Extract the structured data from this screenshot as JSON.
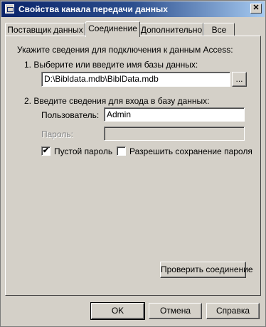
{
  "window": {
    "title": "Свойства канала передачи данных",
    "close_glyph": "✕"
  },
  "tabs": [
    {
      "label": "Поставщик данных"
    },
    {
      "label": "Соединение"
    },
    {
      "label": "Дополнительно"
    },
    {
      "label": "Все"
    }
  ],
  "connection": {
    "intro": "Укажите сведения для подключения к данным Access:",
    "step1_label": "1. Выберите или введите имя базы данных:",
    "db_path": "D:\\Bibldata.mdb\\BiblData.mdb",
    "browse_label": "...",
    "step2_label": "2. Введите сведения для входа в базу данных:",
    "user_label": "Пользователь:",
    "user_value": "Admin",
    "password_label": "Пароль:",
    "password_value": "",
    "blank_password_label": "Пустой пароль",
    "blank_password_checked": true,
    "allow_save_label": "Разрешить сохранение пароля",
    "allow_save_checked": false,
    "test_button": "Проверить соединение"
  },
  "footer": {
    "ok": "OK",
    "cancel": "Отмена",
    "help": "Справка"
  }
}
